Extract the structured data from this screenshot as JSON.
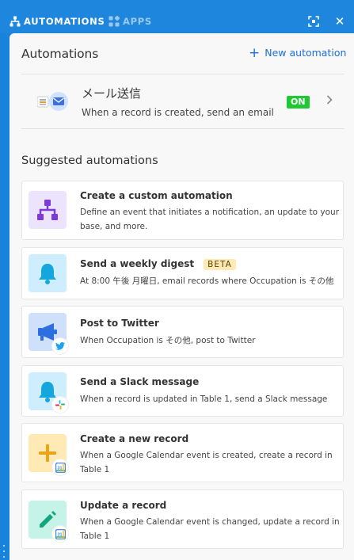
{
  "tabs": {
    "automations": "AUTOMATIONS",
    "apps": "APPS"
  },
  "header": {
    "title": "Automations",
    "new_automation": "New automation"
  },
  "existing_automation": {
    "name": "メール送信",
    "description": "When a record is created, send an email",
    "status": "ON"
  },
  "suggested": {
    "title": "Suggested automations",
    "items": [
      {
        "title": "Create a custom automation",
        "description": "Define an event that initiates a notification, an update to your base, and more.",
        "icon": "custom-automation-icon"
      },
      {
        "title": "Send a weekly digest",
        "badge": "BETA",
        "description": "At 8:00 午後 月曜日, email records where Occupation is その他",
        "icon": "bell-icon"
      },
      {
        "title": "Post to Twitter",
        "description": "When Occupation is その他, post to Twitter",
        "icon": "megaphone-icon"
      },
      {
        "title": "Send a Slack message",
        "description": "When a record is updated in Table 1, send a Slack message",
        "icon": "bell-icon"
      },
      {
        "title": "Create a new record",
        "description": "When a Google Calendar event is created, create a record in Table 1",
        "icon": "plus-icon"
      },
      {
        "title": "Update a record",
        "description": "When a Google Calendar event is changed, update a record in Table 1",
        "icon": "pencil-icon"
      }
    ]
  },
  "colors": {
    "top_bar": "#1f86dd",
    "accent": "#1c6fd8",
    "on_toggle": "#20c933"
  },
  "calendar_badge_text": "31"
}
